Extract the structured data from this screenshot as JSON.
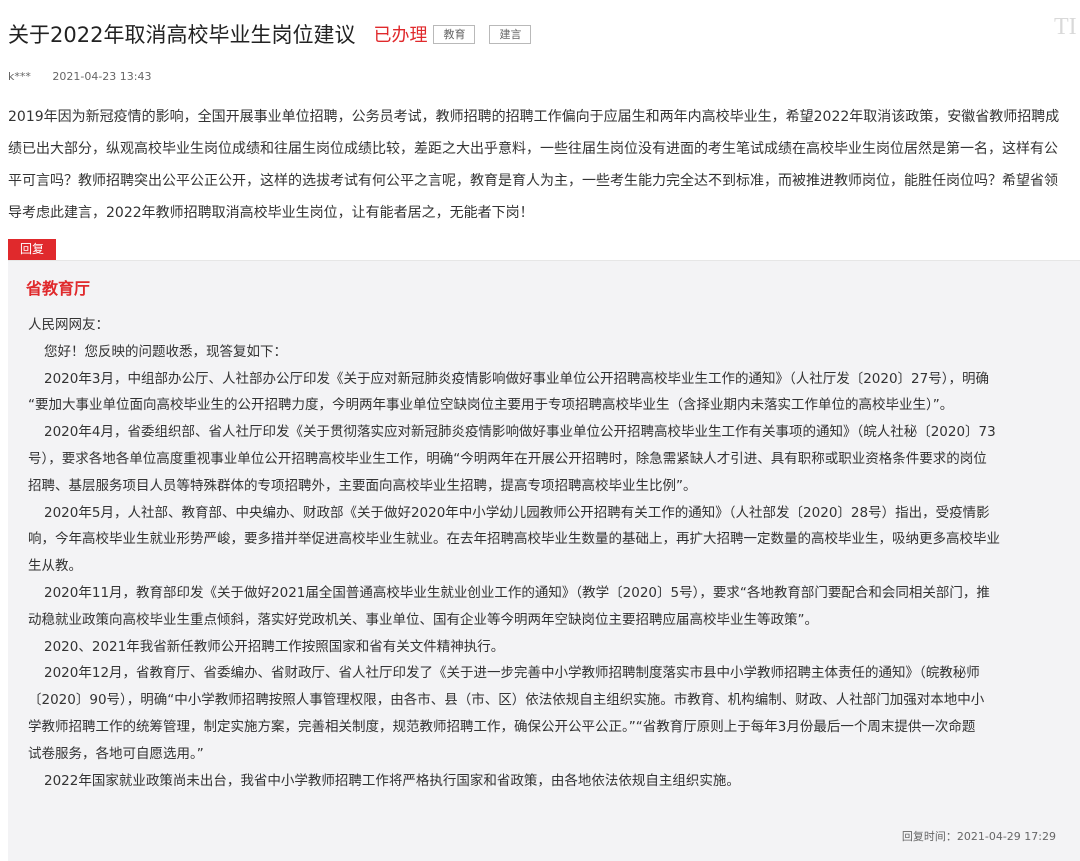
{
  "header": {
    "title": "关于2022年取消高校毕业生岗位建议",
    "status": "已办理",
    "tags": [
      "教育",
      "建言"
    ],
    "corner_logo": "TI"
  },
  "meta": {
    "user": "k***",
    "timestamp": "2021-04-23 13:43"
  },
  "question": {
    "lines": [
      "2019年因为新冠疫情的影响，全国开展事业单位招聘，公务员考试，教师招聘的招聘工作偏向于应届生和两年内高校毕业生，希望2022年取消该政策，安徽省教师招聘成",
      "绩已出大部分，纵观高校毕业生岗位成绩和往届生岗位成绩比较，差距之大出乎意料，一些往届生岗位没有进面的考生笔试成绩在高校毕业生岗位居然是第一名，这样有公",
      "平可言吗？教师招聘突出公平公正公开，这样的选拔考试有何公平之言呢，教育是育人为主，一些考生能力完全达不到标准，而被推进教师岗位，能胜任岗位吗？希望省领",
      "导考虑此建言，2022年教师招聘取消高校毕业生岗位，让有能者居之，无能者下岗！"
    ]
  },
  "reply": {
    "tab_label": "回复",
    "department": "省教育厅",
    "lines": [
      {
        "text": "人民网网友：",
        "indent": false
      },
      {
        "text": "您好！您反映的问题收悉，现答复如下：",
        "indent": true
      },
      {
        "text": "2020年3月，中组部办公厅、人社部办公厅印发《关于应对新冠肺炎疫情影响做好事业单位公开招聘高校毕业生工作的通知》（人社厅发〔2020〕27号），明确",
        "indent": true
      },
      {
        "text": "“要加大事业单位面向高校毕业生的公开招聘力度，今明两年事业单位空缺岗位主要用于专项招聘高校毕业生（含择业期内未落实工作单位的高校毕业生）”。",
        "indent": false
      },
      {
        "text": "2020年4月，省委组织部、省人社厅印发《关于贯彻落实应对新冠肺炎疫情影响做好事业单位公开招聘高校毕业生工作有关事项的通知》（皖人社秘〔2020〕73",
        "indent": true
      },
      {
        "text": "号），要求各地各单位高度重视事业单位公开招聘高校毕业生工作，明确“今明两年在开展公开招聘时，除急需紧缺人才引进、具有职称或职业资格条件要求的岗位",
        "indent": false
      },
      {
        "text": "招聘、基层服务项目人员等特殊群体的专项招聘外，主要面向高校毕业生招聘，提高专项招聘高校毕业生比例”。",
        "indent": false
      },
      {
        "text": "2020年5月，人社部、教育部、中央编办、财政部《关于做好2020年中小学幼儿园教师公开招聘有关工作的通知》（人社部发〔2020〕28号）指出，受疫情影",
        "indent": true
      },
      {
        "text": "响，今年高校毕业生就业形势严峻，要多措并举促进高校毕业生就业。在去年招聘高校毕业生数量的基础上，再扩大招聘一定数量的高校毕业生，吸纳更多高校毕业",
        "indent": false
      },
      {
        "text": "生从教。",
        "indent": false
      },
      {
        "text": "2020年11月，教育部印发《关于做好2021届全国普通高校毕业生就业创业工作的通知》（教学〔2020〕5号），要求“各地教育部门要配合和会同相关部门，推",
        "indent": true
      },
      {
        "text": "动稳就业政策向高校毕业生重点倾斜，落实好党政机关、事业单位、国有企业等今明两年空缺岗位主要招聘应届高校毕业生等政策”。",
        "indent": false
      },
      {
        "text": "2020、2021年我省新任教师公开招聘工作按照国家和省有关文件精神执行。",
        "indent": true
      },
      {
        "text": "2020年12月，省教育厅、省委编办、省财政厅、省人社厅印发了《关于进一步完善中小学教师招聘制度落实市县中小学教师招聘主体责任的通知》（皖教秘师",
        "indent": true
      },
      {
        "text": "〔2020〕90号），明确“中小学教师招聘按照人事管理权限，由各市、县（市、区）依法依规自主组织实施。市教育、机构编制、财政、人社部门加强对本地中小",
        "indent": false
      },
      {
        "text": "学教师招聘工作的统筹管理，制定实施方案，完善相关制度，规范教师招聘工作，确保公开公平公正。”“省教育厅原则上于每年3月份最后一个周末提供一次命题",
        "indent": false
      },
      {
        "text": "试卷服务，各地可自愿选用。”",
        "indent": false
      },
      {
        "text": "2022年国家就业政策尚未出台，我省中小学教师招聘工作将严格执行国家和省政策，由各地依法依规自主组织实施。",
        "indent": true
      }
    ],
    "reply_time": "回复时间：2021-04-29 17:29"
  },
  "colors": {
    "accent": "#e0292c",
    "reply_bg": "#f3f3f5"
  }
}
